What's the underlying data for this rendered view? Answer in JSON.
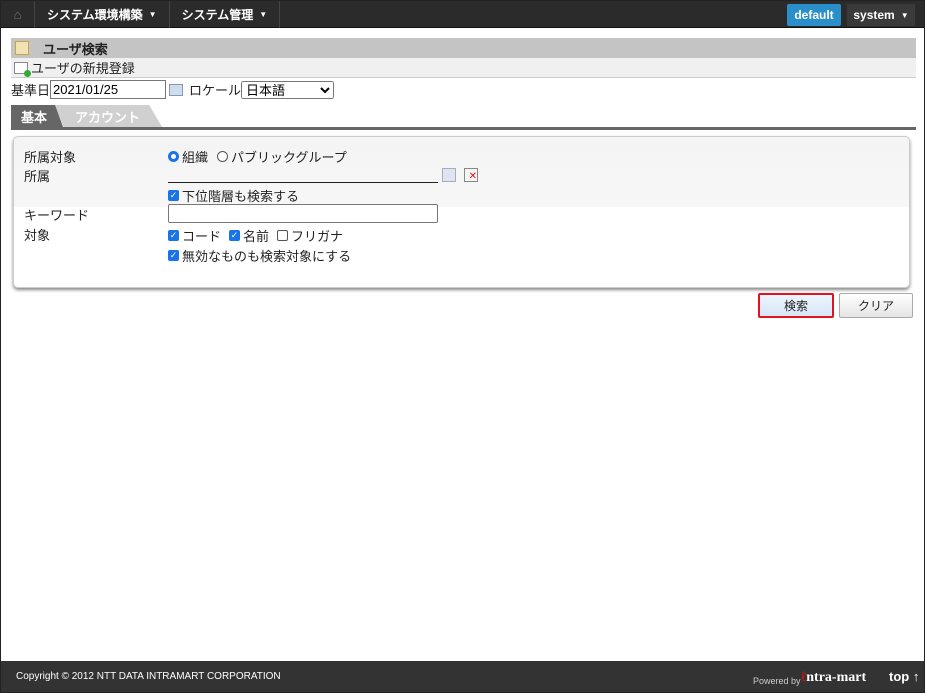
{
  "nav": {
    "menus": [
      "システム環境構築",
      "システム管理"
    ],
    "default_label": "default",
    "user_label": "system"
  },
  "title": "ユーザ検索",
  "new_user_link": "ユーザの新規登録",
  "date": {
    "label": "基準日",
    "value": "2021/01/25",
    "locale_label": "ロケール",
    "locale_value": "日本語"
  },
  "tabs": [
    "基本",
    "アカウント"
  ],
  "form": {
    "target_label": "所属対象",
    "radio_org": "組織",
    "radio_public": "パブリックグループ",
    "affil_label": "所属",
    "include_sub": "下位階層も検索する",
    "keyword_label": "キーワード",
    "keyword_value": "",
    "scope_label": "対象",
    "scope_code": "コード",
    "scope_name": "名前",
    "scope_kana": "フリガナ",
    "include_invalid": "無効なものも検索対象にする"
  },
  "buttons": {
    "search": "検索",
    "clear": "クリア"
  },
  "footer": {
    "copyright": "Copyright © 2012 NTT DATA INTRAMART CORPORATION",
    "powered": "Powered by",
    "logo": "intra-mart",
    "top": "top ↑"
  },
  "colors": {
    "accent": "#2a8fc9",
    "highlight": "#e0141e"
  }
}
